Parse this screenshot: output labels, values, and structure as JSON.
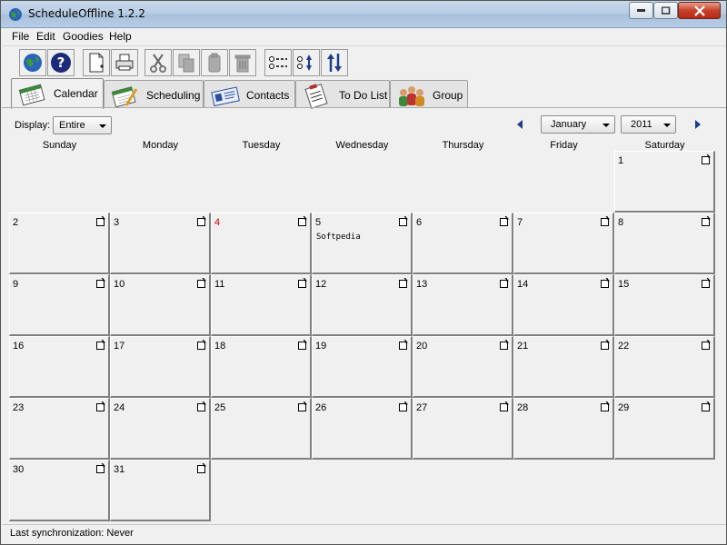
{
  "window": {
    "title": "ScheduleOffline 1.2.2"
  },
  "menu": [
    "File",
    "Edit",
    "Goodies",
    "Help"
  ],
  "toolbar": {
    "buttons": [
      "sync-icon",
      "help-icon",
      "new-icon",
      "print-icon",
      "cut-icon",
      "copy-icon",
      "paste-icon",
      "delete-icon",
      "list-icon",
      "sort-icon",
      "reorder-icon"
    ]
  },
  "tabs": [
    {
      "label": "Calendar",
      "icon": "calendar-icon",
      "active": true
    },
    {
      "label": "Scheduling",
      "icon": "scheduling-icon",
      "active": false
    },
    {
      "label": "Contacts",
      "icon": "contacts-icon",
      "active": false
    },
    {
      "label": "To Do List",
      "icon": "todo-icon",
      "active": false
    },
    {
      "label": "Group",
      "icon": "group-icon",
      "active": false
    }
  ],
  "controls": {
    "display_label": "Display:",
    "display_value": "Entire",
    "month_value": "January",
    "year_value": "2011"
  },
  "weekdays": [
    "Sunday",
    "Monday",
    "Tuesday",
    "Wednesday",
    "Thursday",
    "Friday",
    "Saturday"
  ],
  "calendar": {
    "days": [
      "1",
      "2",
      "3",
      "4",
      "5",
      "6",
      "7",
      "8",
      "9",
      "10",
      "11",
      "12",
      "13",
      "14",
      "15",
      "16",
      "17",
      "18",
      "19",
      "20",
      "21",
      "22",
      "23",
      "24",
      "25",
      "26",
      "27",
      "28",
      "29",
      "30",
      "31"
    ],
    "highlight_day": "4",
    "highlight_color": "#cc0000",
    "events": {
      "5": "Softpedia"
    }
  },
  "status": {
    "text": "Last synchronization: Never"
  }
}
